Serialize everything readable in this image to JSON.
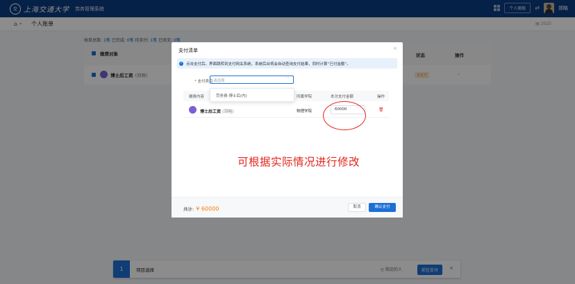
{
  "header": {
    "seal": "交",
    "university": "上海交通大学",
    "system": "劳务管理系统",
    "personal_workbench": "个人面板",
    "username": "郑略"
  },
  "subheader": {
    "breadcrumb": "个人账单",
    "year": "2025"
  },
  "summary": {
    "p1": "账单总数:",
    "v1": "1笔",
    "p2": "已完成:",
    "v2": "0笔",
    "p3": "待支付:",
    "v3": "1笔",
    "p4": "已驳支:",
    "v4": "0笔"
  },
  "table": {
    "col_item": "缴费对象",
    "col_status": "状态",
    "col_op": "操作",
    "row": {
      "name": "博士后工资",
      "sub": "(郑略)",
      "status": "未支付"
    }
  },
  "bottom": {
    "step": "1",
    "label": "项目选择",
    "cart": "购交的人",
    "pay": "前往支付"
  },
  "modal": {
    "title": "支付清单",
    "alert": "点击支付后，界面跳转到支付网关系统，系统后台将会自动查询支付结果，同时计算“已付金额”。",
    "field_label": "支付类目",
    "select_placeholder": "请选择",
    "dropdown_option": "劳务费-博士后(内)",
    "columns": {
      "content": "缴费内容",
      "college": "所属学院",
      "amount": "本次支付金额",
      "op": "操作"
    },
    "row": {
      "name": "博士后工资",
      "sub": "(郑略)",
      "college": "物理学院",
      "amount": "60000"
    },
    "annotation": "可根据实际情况进行修改",
    "total_label": "共计:",
    "total_value": "¥ 60000",
    "cancel": "取消",
    "confirm": "确认支付"
  }
}
